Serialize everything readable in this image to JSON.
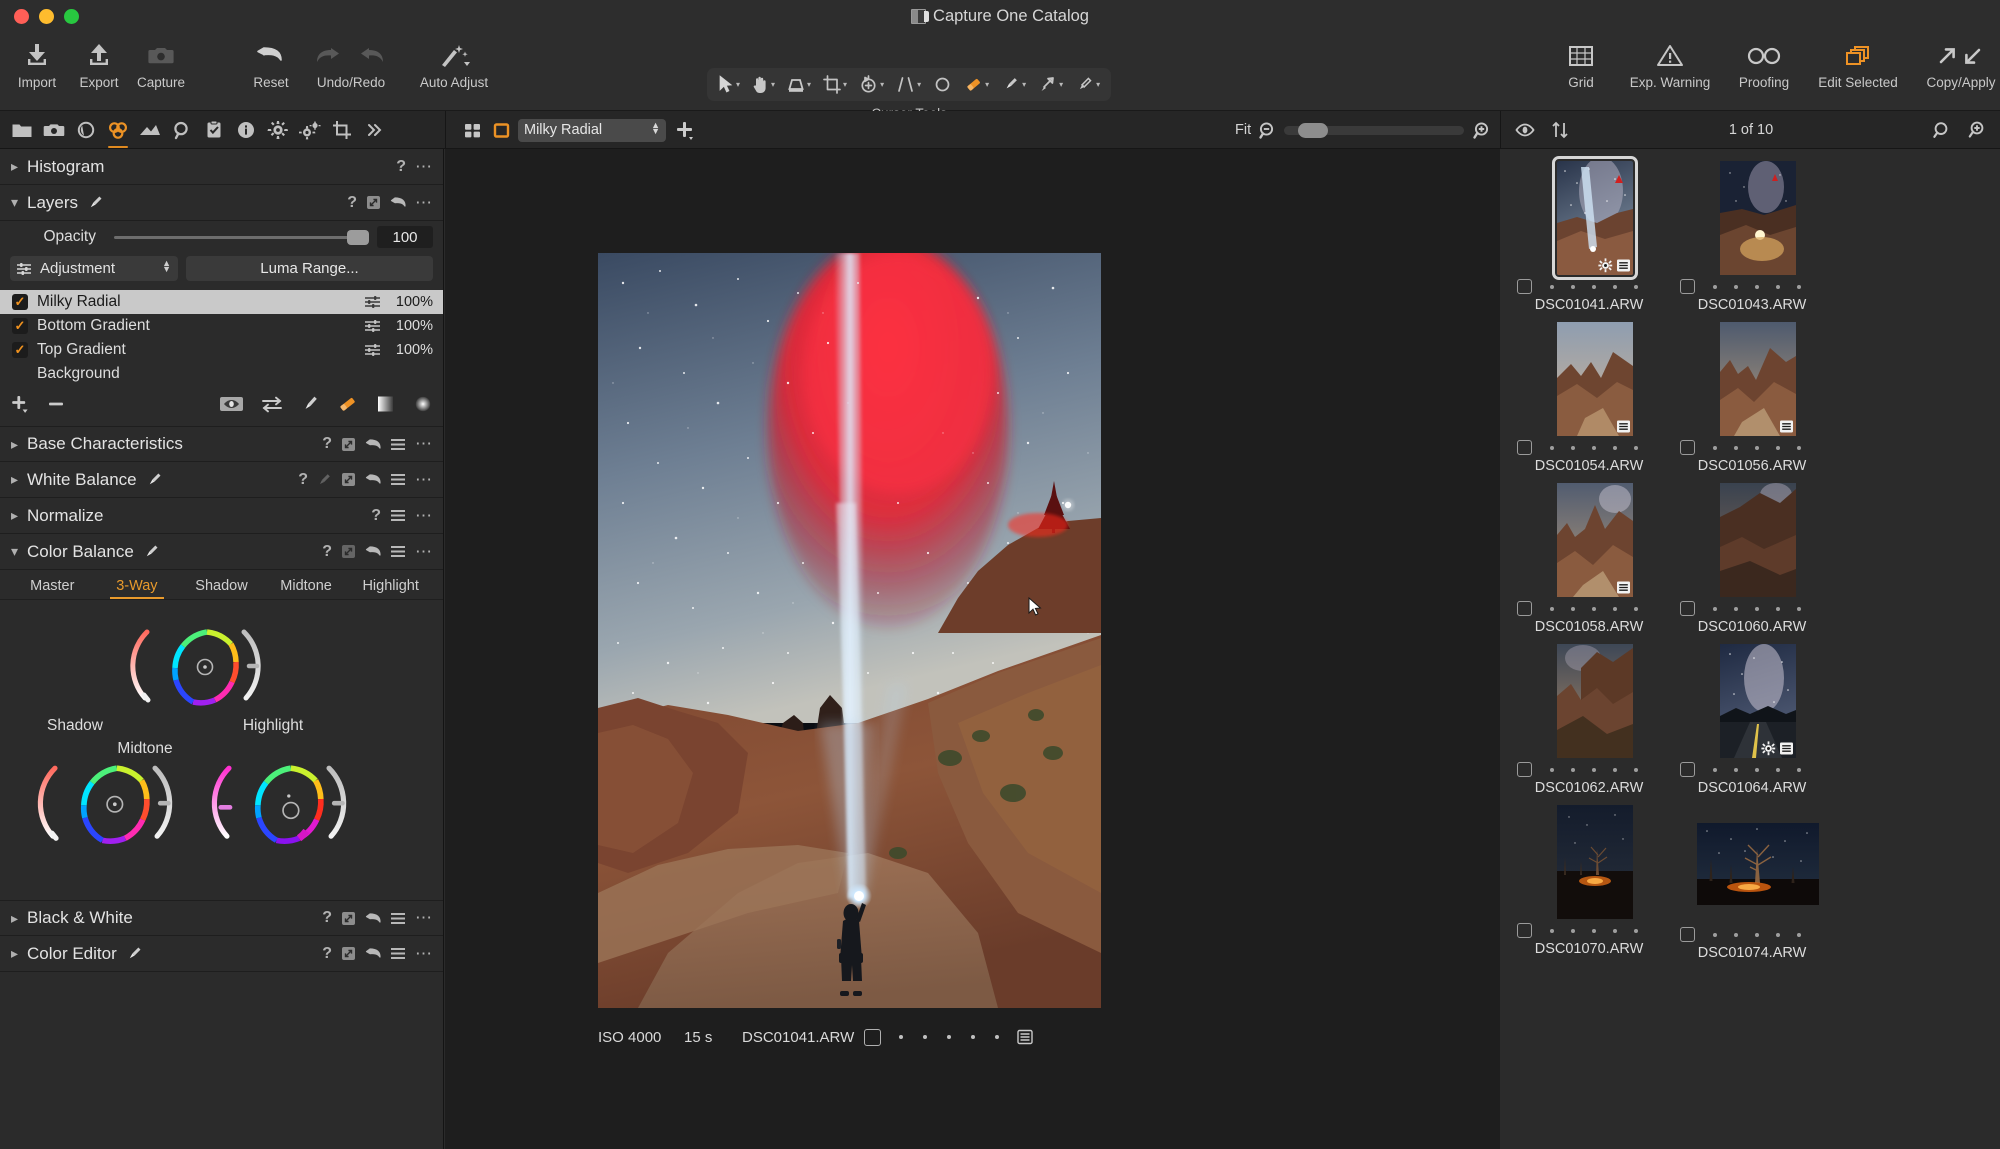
{
  "window": {
    "title": "Capture One Catalog",
    "icon": "catalog-icon"
  },
  "toolbar": {
    "left_group": [
      {
        "label": "Import",
        "icon": "import-icon"
      },
      {
        "label": "Export",
        "icon": "export-icon"
      },
      {
        "label": "Capture",
        "icon": "camera-icon"
      }
    ],
    "middle_group": [
      {
        "label": "Reset",
        "icon": "reset-arrow-icon"
      },
      {
        "label": "Undo/Redo",
        "icon": "undo-redo-icon"
      },
      {
        "label": "Auto Adjust",
        "icon": "magic-wand-icon"
      }
    ],
    "cursor_tools_label": "Cursor Tools",
    "cursor_tools": [
      {
        "name": "pointer-tool",
        "has_menu": true
      },
      {
        "name": "pan-hand-tool",
        "has_menu": true
      },
      {
        "name": "keystone-tool",
        "has_menu": true
      },
      {
        "name": "crop-tool",
        "has_menu": true
      },
      {
        "name": "rotate-tool",
        "has_menu": true
      },
      {
        "name": "straighten-tool",
        "has_menu": true
      },
      {
        "name": "spot-removal-tool",
        "has_menu": false
      },
      {
        "name": "eraser-tool",
        "has_menu": true,
        "active": true
      },
      {
        "name": "draw-mask-tool",
        "has_menu": true
      },
      {
        "name": "gradient-mask-tool",
        "has_menu": true
      },
      {
        "name": "heal-brush-tool",
        "has_menu": true
      }
    ],
    "right_group": [
      {
        "label": "Grid",
        "icon": "grid-icon"
      },
      {
        "label": "Exp. Warning",
        "icon": "warning-triangle-icon"
      },
      {
        "label": "Proofing",
        "icon": "glasses-icon"
      },
      {
        "label": "Edit Selected",
        "icon": "stacked-layers-icon",
        "active": true
      },
      {
        "label": "Copy/Apply",
        "icon": "copy-apply-arrows-icon"
      }
    ]
  },
  "tool_tabs": [
    {
      "name": "library-tab",
      "icon": "folder-icon"
    },
    {
      "name": "capture-tab",
      "icon": "camera-icon"
    },
    {
      "name": "lens-tab",
      "icon": "lens-icon"
    },
    {
      "name": "color-tab",
      "icon": "color-circles-icon",
      "active": true
    },
    {
      "name": "exposure-tab",
      "icon": "exposure-icon"
    },
    {
      "name": "details-tab",
      "icon": "magnifier-icon"
    },
    {
      "name": "adjustments-tab",
      "icon": "clipboard-check-icon"
    },
    {
      "name": "metadata-tab",
      "icon": "info-icon"
    },
    {
      "name": "output-tab",
      "icon": "gear-icon"
    },
    {
      "name": "batch-tab",
      "icon": "gears-icon"
    },
    {
      "name": "crop-tab",
      "icon": "crop-icon"
    },
    {
      "name": "more-tabs",
      "icon": "chevron-double-right-icon"
    }
  ],
  "viewer_bar": {
    "grid_view_icon": "grid-view-icon",
    "single_view_icon": "single-view-icon",
    "layer_selector_value": "Milky Radial",
    "add_layer_icon": "plus-icon",
    "zoom_label": "Fit",
    "zoom_out_icon": "zoom-out-icon",
    "zoom_in_icon": "zoom-in-icon"
  },
  "browser_bar": {
    "view_mode_icon": "eye-icon",
    "sort_icon": "sort-arrows-icon",
    "count_label": "1 of 10",
    "search_icon": "search-icon",
    "zoom_icon": "thumb-zoom-icon"
  },
  "left_panel": {
    "histogram": {
      "title": "Histogram",
      "collapsed": true,
      "icons": [
        "help",
        "menu-dots"
      ]
    },
    "layers": {
      "title": "Layers",
      "collapsed": false,
      "brush_icon": "brush-icon",
      "opacity_label": "Opacity",
      "opacity_value": "100",
      "adjustment_label": "Adjustment",
      "luma_range_label": "Luma Range...",
      "items": [
        {
          "name": "Milky Radial",
          "opacity": "100%",
          "checked": true,
          "selected": true
        },
        {
          "name": "Bottom Gradient",
          "opacity": "100%",
          "checked": true,
          "selected": false
        },
        {
          "name": "Top Gradient",
          "opacity": "100%",
          "checked": true,
          "selected": false
        },
        {
          "name": "Background",
          "opacity": "",
          "checked": false,
          "selected": false
        }
      ],
      "tools": [
        {
          "name": "add-layer-button",
          "icon": "plus-icon"
        },
        {
          "name": "remove-layer-button",
          "icon": "minus-icon"
        },
        {
          "name": "show-mask-button",
          "icon": "eye-mask-icon"
        },
        {
          "name": "invert-mask-button",
          "icon": "invert-arrows-icon"
        },
        {
          "name": "draw-mask-button",
          "icon": "brush-icon"
        },
        {
          "name": "erase-mask-button",
          "icon": "eraser-icon",
          "active": true
        },
        {
          "name": "linear-gradient-button",
          "icon": "linear-gradient-icon"
        },
        {
          "name": "radial-gradient-button",
          "icon": "radial-gradient-icon"
        }
      ]
    },
    "sections": [
      {
        "title": "Base Characteristics",
        "collapsed": true,
        "has_brush": false,
        "icons": [
          "help",
          "expand",
          "reset",
          "menu",
          "dots"
        ]
      },
      {
        "title": "White Balance",
        "collapsed": true,
        "has_brush": true,
        "icons": [
          "help",
          "picker",
          "expand",
          "reset",
          "menu",
          "dots"
        ]
      },
      {
        "title": "Normalize",
        "collapsed": true,
        "has_brush": false,
        "icons": [
          "help",
          "menu",
          "dots"
        ]
      },
      {
        "title": "Color Balance",
        "collapsed": false,
        "has_brush": true,
        "icons": [
          "help",
          "expand",
          "reset",
          "menu",
          "dots"
        ]
      }
    ],
    "color_balance": {
      "tabs": [
        {
          "label": "Master",
          "active": false
        },
        {
          "label": "3-Way",
          "active": true
        },
        {
          "label": "Shadow",
          "active": false
        },
        {
          "label": "Midtone",
          "active": false
        },
        {
          "label": "Highlight",
          "active": false
        }
      ],
      "wheels": [
        {
          "label": "Midtone",
          "name": "midtone-wheel"
        },
        {
          "label": "Shadow",
          "name": "shadow-wheel"
        },
        {
          "label": "Highlight",
          "name": "highlight-wheel"
        }
      ]
    },
    "bottom_sections": [
      {
        "title": "Black & White",
        "collapsed": true,
        "has_brush": false
      },
      {
        "title": "Color Editor",
        "collapsed": true,
        "has_brush": true
      }
    ]
  },
  "viewer": {
    "info": {
      "iso": "ISO 4000",
      "shutter": "15 s",
      "filename": "DSC01041.ARW",
      "rating_dots": 5,
      "notes_icon": "notes-icon",
      "color_tag_icon": "color-tag-icon"
    }
  },
  "browser": {
    "thumbnails": [
      {
        "filename": "DSC01041.ARW",
        "orientation": "portrait",
        "selected": true,
        "badges": [
          "gear-icon",
          "notes-icon"
        ],
        "theme": "milky-beam"
      },
      {
        "filename": "DSC01043.ARW",
        "orientation": "portrait",
        "selected": false,
        "badges": [],
        "theme": "canyon-light"
      },
      {
        "filename": "DSC01054.ARW",
        "orientation": "portrait",
        "selected": false,
        "badges": [
          "notes-icon"
        ],
        "theme": "hoodoo-dusk"
      },
      {
        "filename": "DSC01056.ARW",
        "orientation": "portrait",
        "selected": false,
        "badges": [
          "notes-icon"
        ],
        "theme": "hoodoo-trail"
      },
      {
        "filename": "DSC01058.ARW",
        "orientation": "portrait",
        "selected": false,
        "badges": [
          "notes-icon"
        ],
        "theme": "hoodoo-trail2"
      },
      {
        "filename": "DSC01060.ARW",
        "orientation": "portrait",
        "selected": false,
        "badges": [],
        "theme": "hoodoo-dark"
      },
      {
        "filename": "DSC01062.ARW",
        "orientation": "portrait",
        "selected": false,
        "badges": [],
        "theme": "hoodoo-night"
      },
      {
        "filename": "DSC01064.ARW",
        "orientation": "portrait",
        "selected": false,
        "badges": [
          "gear-icon",
          "notes-icon"
        ],
        "theme": "milky-road"
      },
      {
        "filename": "DSC01070.ARW",
        "orientation": "portrait",
        "selected": false,
        "badges": [],
        "theme": "tree-fire"
      },
      {
        "filename": "DSC01074.ARW",
        "orientation": "landscape",
        "selected": false,
        "badges": [],
        "theme": "tree-fire-wide"
      }
    ]
  }
}
